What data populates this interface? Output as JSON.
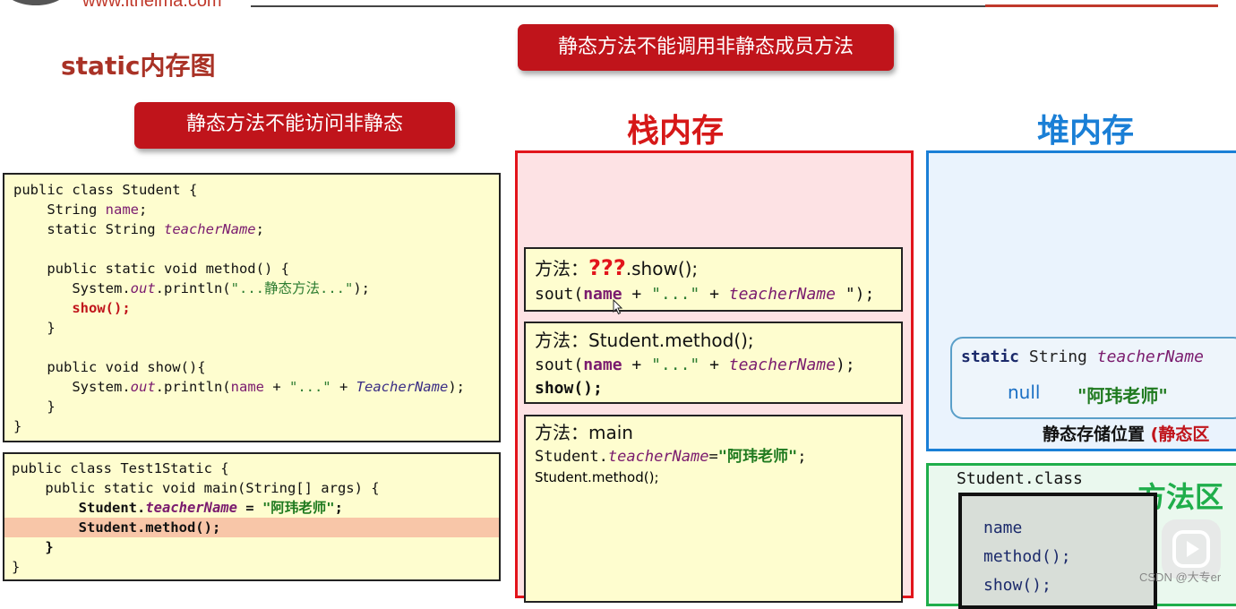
{
  "header": {
    "site_url": "www.itheima.com",
    "page_title": "static内存图"
  },
  "banners": {
    "top": "静态方法不能调用非静态成员方法",
    "left": "静态方法不能访问非静态"
  },
  "code_student": {
    "l1": "public class Student {",
    "l2_a": "    String ",
    "l2_b": "name",
    "l2_c": ";",
    "l3_a": "    static String ",
    "l3_b": "teacherName",
    "l3_c": ";",
    "l5": "    public static void method() {",
    "l6_a": "       System.",
    "l6_b": "out",
    "l6_c": ".println(",
    "l6_d": "\"...静态方法...\"",
    "l6_e": ");",
    "l7": "       show();",
    "l8": "    }",
    "l10": "    public void show(){",
    "l11_a": "       System.",
    "l11_b": "out",
    "l11_c": ".println(",
    "l11_d": "name",
    "l11_e": " + ",
    "l11_f": "\"...\"",
    "l11_g": " + ",
    "l11_h": "TeacherName",
    "l11_i": ");",
    "l12": "    }",
    "l13": "}"
  },
  "code_test": {
    "l1": "public class Test1Static {",
    "l2": "    public static void main(String[] args) {",
    "l3_a": "        Student.",
    "l3_b": "teacherName",
    "l3_c": " = ",
    "l3_d": "\"阿玮老师\"",
    "l3_e": ";",
    "l4": "        Student.method();",
    "l5": "    }",
    "l6": "}"
  },
  "stack": {
    "title": "栈内存",
    "frame_show": {
      "label": "方法：",
      "unknown": "???",
      "call": ".show();",
      "line2_a": "sout(",
      "line2_b": "name",
      "line2_c": " + ",
      "line2_d": "\"...\"",
      "line2_e": " + ",
      "line2_f": "teacherName",
      "line2_g": " \");"
    },
    "frame_method": {
      "label": "方法：",
      "call": "Student.method();",
      "line2_a": "sout(",
      "line2_b": "name",
      "line2_c": " + ",
      "line2_d": "\"...\"",
      "line2_e": " + ",
      "line2_f": "teacherName",
      "line2_g": ");",
      "line3": "show();"
    },
    "frame_main": {
      "label": "方法：",
      "name": "main",
      "line2_a": "Student.",
      "line2_b": "teacherName",
      "line2_c": "=",
      "line2_d": "\"阿玮老师\"",
      "line2_e": ";",
      "line3": "Student.method();"
    }
  },
  "heap": {
    "title": "堆内存",
    "static_decl_a": "static",
    "static_decl_b": " String ",
    "static_decl_c": "teacherName",
    "null_text": "null",
    "value_text": "\"阿玮老师\"",
    "caption_a": "静态存储位置",
    "caption_b": "(静态区"
  },
  "method_area": {
    "title": "方法区",
    "class_name": "Student.class",
    "members": [
      "name",
      "method();",
      "show();"
    ]
  },
  "watermark": "CSDN @大专er"
}
